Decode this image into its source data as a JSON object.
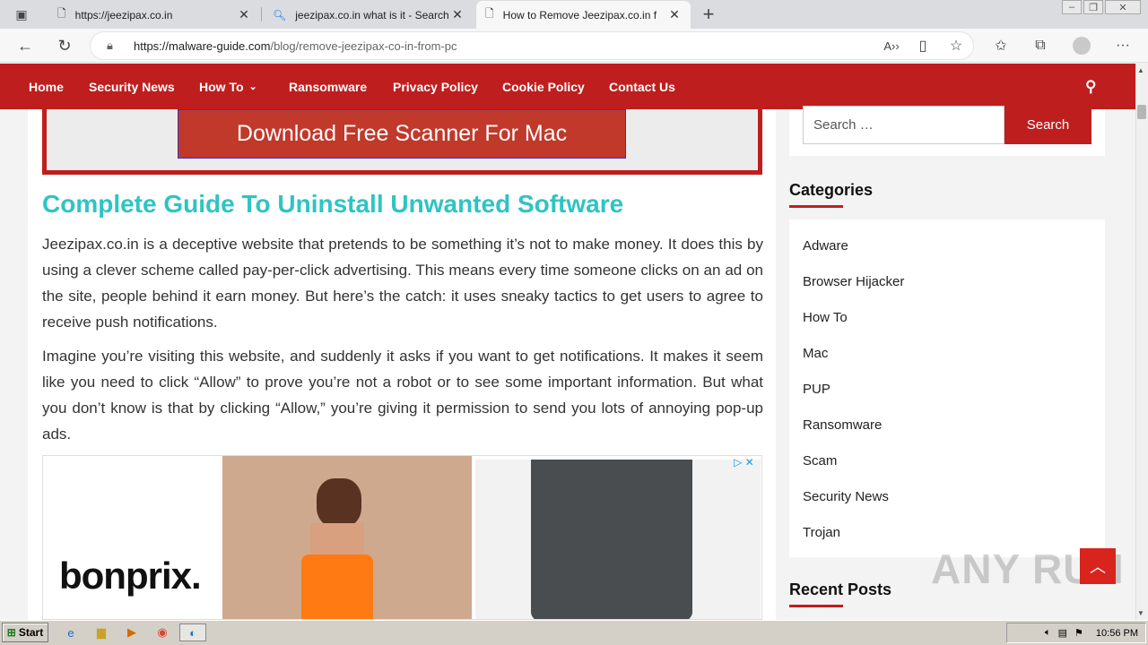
{
  "browser": {
    "tabs": [
      {
        "label": "https://jeezipax.co.in",
        "icon": "page-icon"
      },
      {
        "label": "jeezipax.co.in what is it - Search",
        "icon": "search-icon"
      },
      {
        "label": "How to Remove Jeezipax.co.in f",
        "icon": "page-icon",
        "active": true
      }
    ],
    "url_host": "https://malware-guide.com",
    "url_path": "/blog/remove-jeezipax-co-in-from-pc"
  },
  "nav": {
    "items": [
      "Home",
      "Security News",
      "How To",
      "Ransomware",
      "Privacy Policy",
      "Cookie Policy",
      "Contact Us"
    ]
  },
  "main": {
    "scanner_button": "Download Free Scanner For Mac",
    "heading": "Complete Guide To Uninstall Unwanted Software",
    "para1": "Jeezipax.co.in is a deceptive website that pretends to be something it’s not to make money. It does this by using a clever scheme called pay-per-click advertising. This means every time someone clicks on an ad on the site, people behind it earn money. But here’s the catch: it uses sneaky tactics to get users to agree to receive push notifications.",
    "para2": "Imagine you’re visiting this website, and suddenly it asks if you want to get notifications. It makes it seem like you need to click “Allow” to prove you’re not a robot or to see some important information. But what you don’t know is that by clicking “Allow,” you’re giving it permission to send you lots of annoying pop-up ads.",
    "ad_brand": "bonprix."
  },
  "sidebar": {
    "search_placeholder": "Search …",
    "search_button": "Search",
    "categories_title": "Categories",
    "categories": [
      "Adware",
      "Browser Hijacker",
      "How To",
      "Mac",
      "PUP",
      "Ransomware",
      "Scam",
      "Security News",
      "Trojan"
    ],
    "recent_title": "Recent Posts"
  },
  "watermark": "ANY RUN",
  "taskbar": {
    "start": "Start",
    "time": "10:56 PM"
  },
  "colors": {
    "brand_red": "#bf1e1e",
    "heading_teal": "#2ec4c4"
  }
}
